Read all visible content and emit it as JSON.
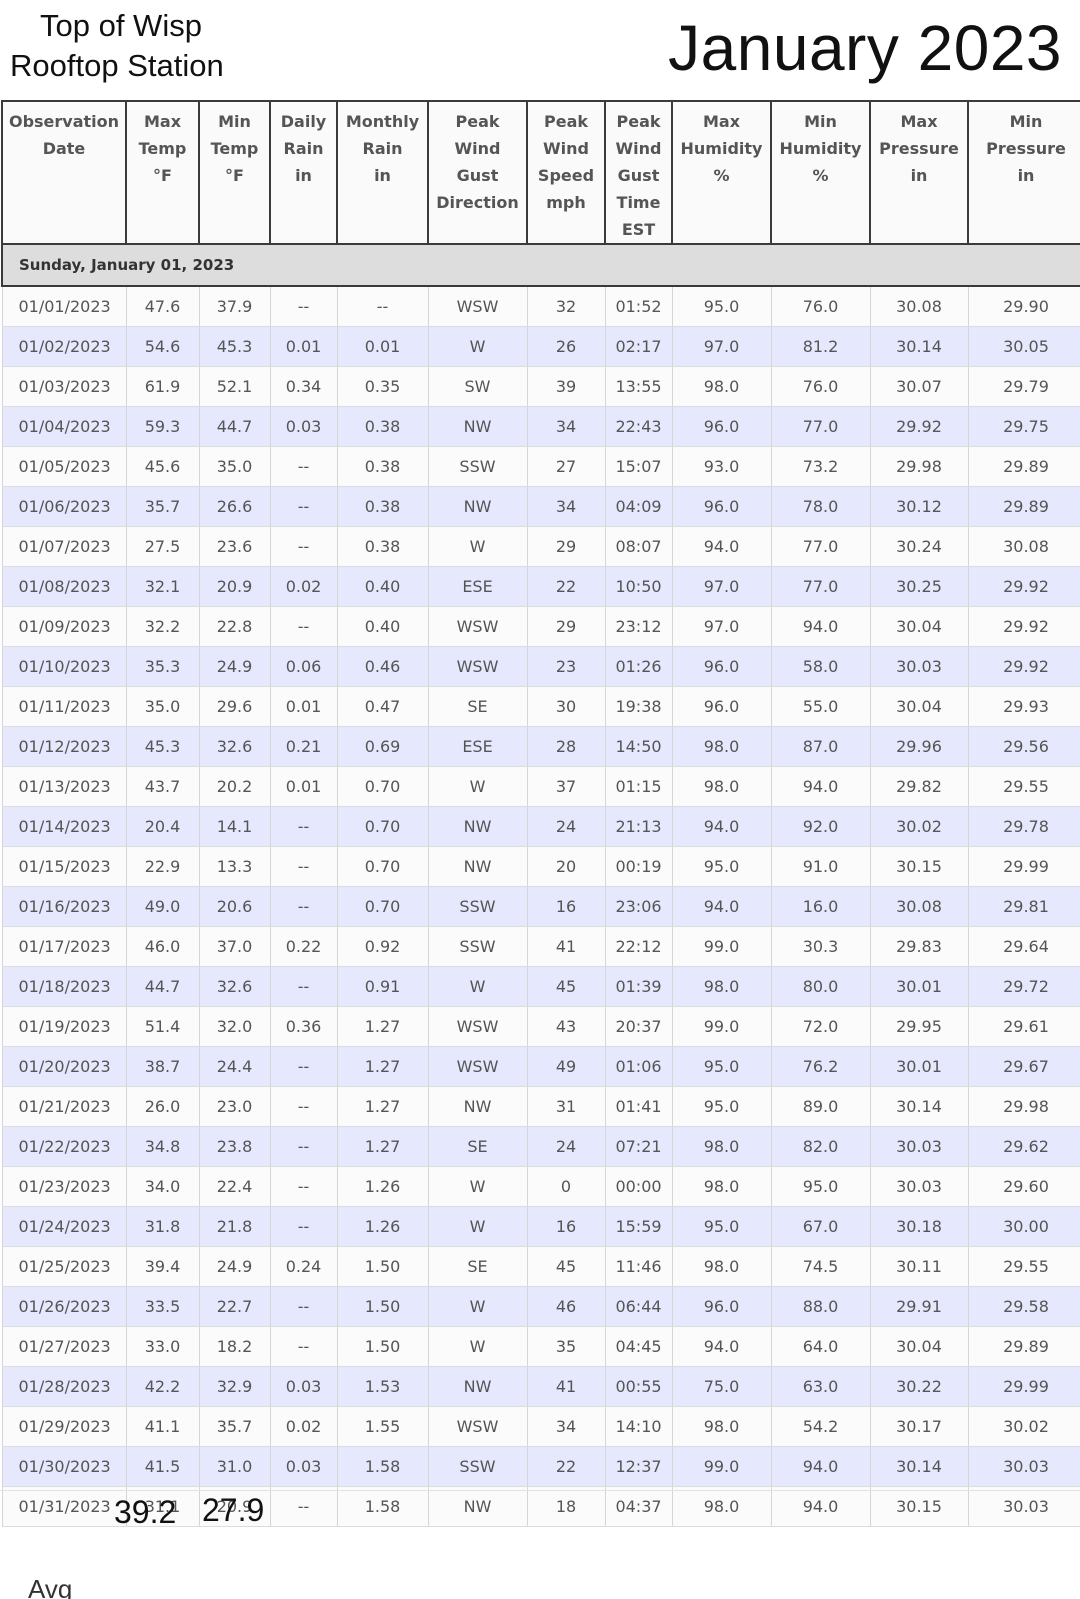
{
  "header": {
    "station_line1": "Top of Wisp",
    "station_line2": "Rooftop Station",
    "month_title": "January 2023"
  },
  "table": {
    "columns": [
      [
        "Observation",
        "Date"
      ],
      [
        "Max",
        "Temp",
        "°F"
      ],
      [
        "Min",
        "Temp",
        "°F"
      ],
      [
        "Daily",
        "Rain",
        "in"
      ],
      [
        "Monthly",
        "Rain",
        "in"
      ],
      [
        "Peak",
        "Wind",
        "Gust",
        "Direction"
      ],
      [
        "Peak",
        "Wind",
        "Speed",
        "mph"
      ],
      [
        "Peak",
        "Wind",
        "Gust",
        "Time",
        "EST"
      ],
      [
        "Max",
        "Humidity",
        "%"
      ],
      [
        "Min",
        "Humidity",
        "%"
      ],
      [
        "Max",
        "Pressure",
        "in"
      ],
      [
        "Min",
        "Pressure",
        "in"
      ]
    ],
    "group_label": "Sunday, January 01, 2023",
    "rows": [
      [
        "01/01/2023",
        "47.6",
        "37.9",
        "--",
        "--",
        "WSW",
        "32",
        "01:52",
        "95.0",
        "76.0",
        "30.08",
        "29.90"
      ],
      [
        "01/02/2023",
        "54.6",
        "45.3",
        "0.01",
        "0.01",
        "W",
        "26",
        "02:17",
        "97.0",
        "81.2",
        "30.14",
        "30.05"
      ],
      [
        "01/03/2023",
        "61.9",
        "52.1",
        "0.34",
        "0.35",
        "SW",
        "39",
        "13:55",
        "98.0",
        "76.0",
        "30.07",
        "29.79"
      ],
      [
        "01/04/2023",
        "59.3",
        "44.7",
        "0.03",
        "0.38",
        "NW",
        "34",
        "22:43",
        "96.0",
        "77.0",
        "29.92",
        "29.75"
      ],
      [
        "01/05/2023",
        "45.6",
        "35.0",
        "--",
        "0.38",
        "SSW",
        "27",
        "15:07",
        "93.0",
        "73.2",
        "29.98",
        "29.89"
      ],
      [
        "01/06/2023",
        "35.7",
        "26.6",
        "--",
        "0.38",
        "NW",
        "34",
        "04:09",
        "96.0",
        "78.0",
        "30.12",
        "29.89"
      ],
      [
        "01/07/2023",
        "27.5",
        "23.6",
        "--",
        "0.38",
        "W",
        "29",
        "08:07",
        "94.0",
        "77.0",
        "30.24",
        "30.08"
      ],
      [
        "01/08/2023",
        "32.1",
        "20.9",
        "0.02",
        "0.40",
        "ESE",
        "22",
        "10:50",
        "97.0",
        "77.0",
        "30.25",
        "29.92"
      ],
      [
        "01/09/2023",
        "32.2",
        "22.8",
        "--",
        "0.40",
        "WSW",
        "29",
        "23:12",
        "97.0",
        "94.0",
        "30.04",
        "29.92"
      ],
      [
        "01/10/2023",
        "35.3",
        "24.9",
        "0.06",
        "0.46",
        "WSW",
        "23",
        "01:26",
        "96.0",
        "58.0",
        "30.03",
        "29.92"
      ],
      [
        "01/11/2023",
        "35.0",
        "29.6",
        "0.01",
        "0.47",
        "SE",
        "30",
        "19:38",
        "96.0",
        "55.0",
        "30.04",
        "29.93"
      ],
      [
        "01/12/2023",
        "45.3",
        "32.6",
        "0.21",
        "0.69",
        "ESE",
        "28",
        "14:50",
        "98.0",
        "87.0",
        "29.96",
        "29.56"
      ],
      [
        "01/13/2023",
        "43.7",
        "20.2",
        "0.01",
        "0.70",
        "W",
        "37",
        "01:15",
        "98.0",
        "94.0",
        "29.82",
        "29.55"
      ],
      [
        "01/14/2023",
        "20.4",
        "14.1",
        "--",
        "0.70",
        "NW",
        "24",
        "21:13",
        "94.0",
        "92.0",
        "30.02",
        "29.78"
      ],
      [
        "01/15/2023",
        "22.9",
        "13.3",
        "--",
        "0.70",
        "NW",
        "20",
        "00:19",
        "95.0",
        "91.0",
        "30.15",
        "29.99"
      ],
      [
        "01/16/2023",
        "49.0",
        "20.6",
        "--",
        "0.70",
        "SSW",
        "16",
        "23:06",
        "94.0",
        "16.0",
        "30.08",
        "29.81"
      ],
      [
        "01/17/2023",
        "46.0",
        "37.0",
        "0.22",
        "0.92",
        "SSW",
        "41",
        "22:12",
        "99.0",
        "30.3",
        "29.83",
        "29.64"
      ],
      [
        "01/18/2023",
        "44.7",
        "32.6",
        "--",
        "0.91",
        "W",
        "45",
        "01:39",
        "98.0",
        "80.0",
        "30.01",
        "29.72"
      ],
      [
        "01/19/2023",
        "51.4",
        "32.0",
        "0.36",
        "1.27",
        "WSW",
        "43",
        "20:37",
        "99.0",
        "72.0",
        "29.95",
        "29.61"
      ],
      [
        "01/20/2023",
        "38.7",
        "24.4",
        "--",
        "1.27",
        "WSW",
        "49",
        "01:06",
        "95.0",
        "76.2",
        "30.01",
        "29.67"
      ],
      [
        "01/21/2023",
        "26.0",
        "23.0",
        "--",
        "1.27",
        "NW",
        "31",
        "01:41",
        "95.0",
        "89.0",
        "30.14",
        "29.98"
      ],
      [
        "01/22/2023",
        "34.8",
        "23.8",
        "--",
        "1.27",
        "SE",
        "24",
        "07:21",
        "98.0",
        "82.0",
        "30.03",
        "29.62"
      ],
      [
        "01/23/2023",
        "34.0",
        "22.4",
        "--",
        "1.26",
        "W",
        "0",
        "00:00",
        "98.0",
        "95.0",
        "30.03",
        "29.60"
      ],
      [
        "01/24/2023",
        "31.8",
        "21.8",
        "--",
        "1.26",
        "W",
        "16",
        "15:59",
        "95.0",
        "67.0",
        "30.18",
        "30.00"
      ],
      [
        "01/25/2023",
        "39.4",
        "24.9",
        "0.24",
        "1.50",
        "SE",
        "45",
        "11:46",
        "98.0",
        "74.5",
        "30.11",
        "29.55"
      ],
      [
        "01/26/2023",
        "33.5",
        "22.7",
        "--",
        "1.50",
        "W",
        "46",
        "06:44",
        "96.0",
        "88.0",
        "29.91",
        "29.58"
      ],
      [
        "01/27/2023",
        "33.0",
        "18.2",
        "--",
        "1.50",
        "W",
        "35",
        "04:45",
        "94.0",
        "64.0",
        "30.04",
        "29.89"
      ],
      [
        "01/28/2023",
        "42.2",
        "32.9",
        "0.03",
        "1.53",
        "NW",
        "41",
        "00:55",
        "75.0",
        "63.0",
        "30.22",
        "29.99"
      ],
      [
        "01/29/2023",
        "41.1",
        "35.7",
        "0.02",
        "1.55",
        "WSW",
        "34",
        "14:10",
        "98.0",
        "54.2",
        "30.17",
        "30.02"
      ],
      [
        "01/30/2023",
        "41.5",
        "31.0",
        "0.03",
        "1.58",
        "SSW",
        "22",
        "12:37",
        "99.0",
        "94.0",
        "30.14",
        "30.03"
      ],
      [
        "01/31/2023",
        "31.1",
        "20.9",
        "--",
        "1.58",
        "NW",
        "18",
        "04:37",
        "98.0",
        "94.0",
        "30.15",
        "30.03"
      ]
    ]
  },
  "summary": {
    "avg_max_temp": "39.2",
    "avg_min_temp": "27.9",
    "avg_label": "Avg"
  }
}
